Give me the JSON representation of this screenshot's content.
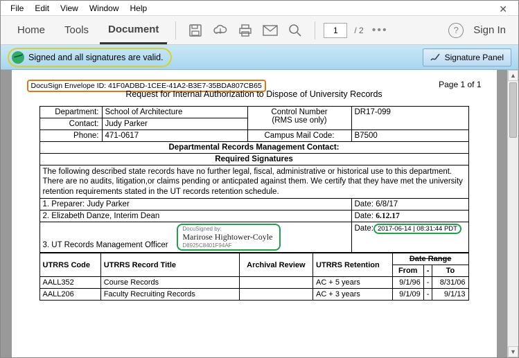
{
  "menu": {
    "file": "File",
    "edit": "Edit",
    "view": "View",
    "window": "Window",
    "help": "Help"
  },
  "tabs": {
    "home": "Home",
    "tools": "Tools",
    "document": "Document"
  },
  "pager": {
    "current": "1",
    "total": "/ 2"
  },
  "signin": "Sign In",
  "sigbar": {
    "msg": "Signed and all signatures are valid.",
    "panel": "Signature Panel"
  },
  "envId": "DocuSign Envelope ID: 41F0ADBD-1CEE-41A2-B3E7-35BDA807CB65",
  "docTitle": "Request for Internal Authorization to Dispose of University Records",
  "pageNum": "Page 1 of 1",
  "f": {
    "dept_l": "Department:",
    "dept": "School of Architecture",
    "ctrl_l": "Control Number\n(RMS use only)",
    "ctrl": "DR17-099",
    "contact_l": "Contact:",
    "contact": "Judy Parker",
    "phone_l": "Phone:",
    "phone": "471-0617",
    "mail_l": "Campus Mail Code:",
    "mail": "B7500",
    "drmc": "Departmental Records Management Contact:",
    "req": "Required Signatures",
    "para": "The following described state records have no further legal, fiscal, administrative or historical use to this department. There are no audits, litigation,or claims pending or anticpated against them.  We certify that they have met the university retention requirements stated in the UT records retention schedule.",
    "p1": "1. Preparer:  Judy Parker",
    "p1d_l": "Date:",
    "p1d": "6/8/17",
    "p2": "2. Elizabeth Danze, Interim Dean",
    "p2d_l": "Date:",
    "p2d": "6.12.17",
    "p3": "3. UT Records Management Officer",
    "sig_by": "DocuSigned by:",
    "sig_name": "Marirose Hightower-Coyle",
    "sig_id": "D8925C8401F94AF",
    "p3d_l": "Date:",
    "p3d": "2017-06-14 | 08:31:44 PDT"
  },
  "grid": {
    "h1": "UTRRS Code",
    "h2": "UTRRS Record Title",
    "h3": "Archival Review",
    "h4": "UTRRS Retention",
    "h5": "Date Range",
    "h5a": "From",
    "h5b": "To",
    "r1": {
      "c": "AALL352",
      "t": "Course Records",
      "a": "",
      "r": "AC + 5 years",
      "f": "9/1/96",
      "to": "8/31/06"
    },
    "r2": {
      "c": "AALL206",
      "t": "Faculty Recruiting Records",
      "a": "",
      "r": "AC + 3 years",
      "f": "9/1/09",
      "to": "9/1/13"
    }
  }
}
